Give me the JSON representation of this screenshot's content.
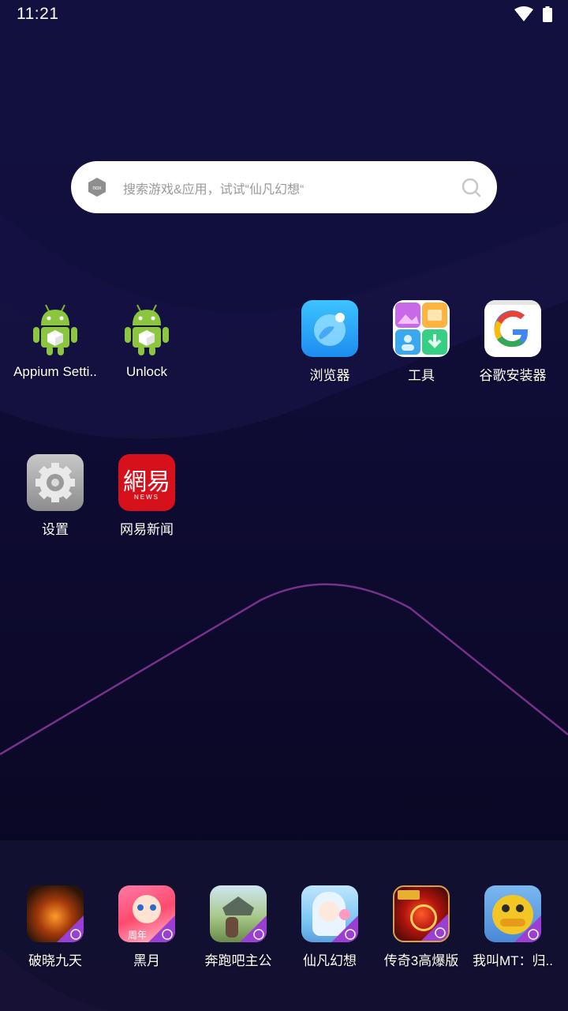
{
  "status_bar": {
    "time": "11:21"
  },
  "search": {
    "placeholder": "搜索游戏&应用，试试“仙凡幻想“",
    "logo_text": "nox"
  },
  "home_apps": [
    {
      "label": "Appium Setti..",
      "icon": "android-icon"
    },
    {
      "label": "Unlock",
      "icon": "android-icon"
    },
    {
      "label": "浏览器",
      "icon": "browser-icon"
    },
    {
      "label": "工具",
      "icon": "tools-folder-icon"
    },
    {
      "label": "谷歌安装器",
      "icon": "google-icon"
    },
    {
      "label": "设置",
      "icon": "settings-gear-icon"
    },
    {
      "label": "网易新闻",
      "icon": "netease-news-icon",
      "logo_text": "網易",
      "logo_sub": "NEWS"
    }
  ],
  "dock_apps": [
    {
      "label": "破晓九天",
      "icon": "game-icon"
    },
    {
      "label": "黑月",
      "icon": "game-icon",
      "badge_text": "周年"
    },
    {
      "label": "奔跑吧主公",
      "icon": "game-icon"
    },
    {
      "label": "仙凡幻想",
      "icon": "game-icon"
    },
    {
      "label": "传奇3高爆版",
      "icon": "game-icon"
    },
    {
      "label": "我叫MT：归..",
      "icon": "game-icon"
    }
  ],
  "colors": {
    "accent_line": "#8a3a9a",
    "nox_purple": "#9b3fd4"
  }
}
